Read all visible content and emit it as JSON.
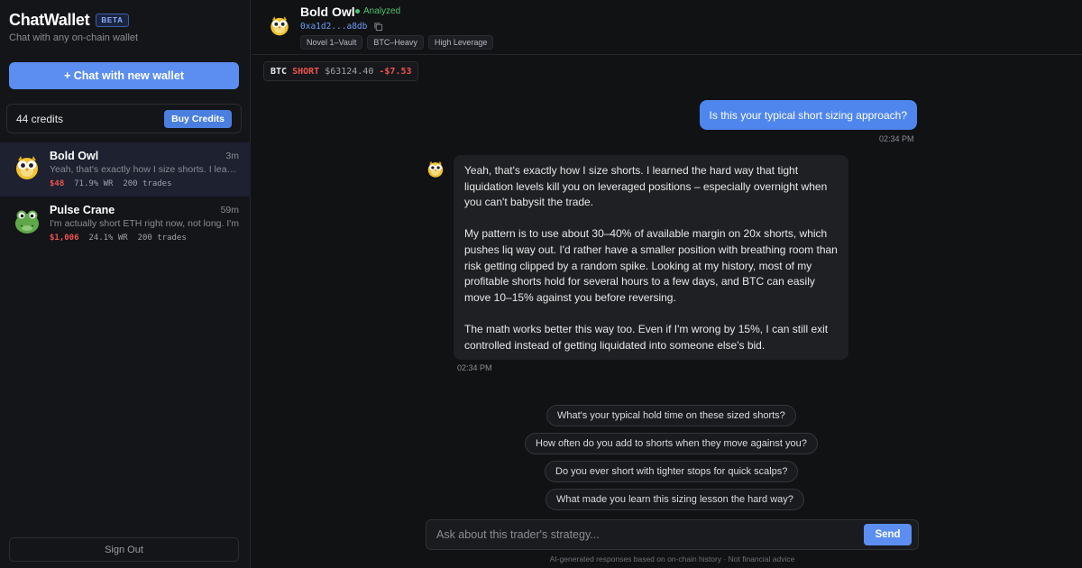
{
  "sidebar": {
    "brand": "ChatWallet",
    "badge": "BETA",
    "tagline": "Chat with any on-chain wallet",
    "new_chat_label": "+ Chat with new wallet",
    "credits_label": "44 credits",
    "buy_credits_label": "Buy Credits",
    "chats": [
      {
        "name": "Bold Owl",
        "time": "3m",
        "preview": "Yeah, that's exactly how I size shorts. I learned the hard way",
        "pnl": "$48",
        "win_rate": "71.9% WR",
        "trades": "200 trades",
        "avatar_icon": "owl-avatar-icon"
      },
      {
        "name": "Pulse Crane",
        "time": "59m",
        "preview": "I'm actually short ETH right now, not long. I'm",
        "pnl": "$1,006",
        "win_rate": "24.1% WR",
        "trades": "200 trades",
        "avatar_icon": "frog-avatar-icon"
      }
    ],
    "sign_out_label": "Sign Out"
  },
  "header": {
    "name": "Bold Owl",
    "status": "Analyzed",
    "address": "0xa1d2...a8db",
    "tags": [
      "Novel 1–Vault",
      "BTC–Heavy",
      "High Leverage"
    ]
  },
  "position": {
    "asset": "BTC",
    "side": "SHORT",
    "price": "$63124.40",
    "pnl": "-$7.53"
  },
  "messages": {
    "user_text": "Is this your typical short sizing approach?",
    "user_time": "02:34 PM",
    "bot_paragraphs": [
      "Yeah, that's exactly how I size shorts. I learned the hard way that tight liquidation levels kill you on leveraged positions – especially overnight when you can't babysit the trade.",
      "My pattern is to use about 30–40% of available margin on 20x shorts, which pushes liq way out. I'd rather have a smaller position with breathing room than risk getting clipped by a random spike. Looking at my history, most of my profitable shorts hold for several hours to a few days, and BTC can easily move 10–15% against you before reversing.",
      "The math works better this way too. Even if I'm wrong by 15%, I can still exit controlled instead of getting liquidated into someone else's bid."
    ],
    "bot_time": "02:34 PM"
  },
  "suggestions": [
    "What's your typical hold time on these sized shorts?",
    "How often do you add to shorts when they move against you?",
    "Do you ever short with tighter stops for quick scalps?",
    "What made you learn this sizing lesson the hard way?"
  ],
  "composer": {
    "placeholder": "Ask about this trader's strategy...",
    "send_label": "Send",
    "disclaimer": "AI-generated responses based on on-chain history · Not financial advice"
  },
  "colors": {
    "accent": "#5b8ef0",
    "negative": "#ef5350",
    "positive": "#4ec26c",
    "background": "#111214"
  }
}
